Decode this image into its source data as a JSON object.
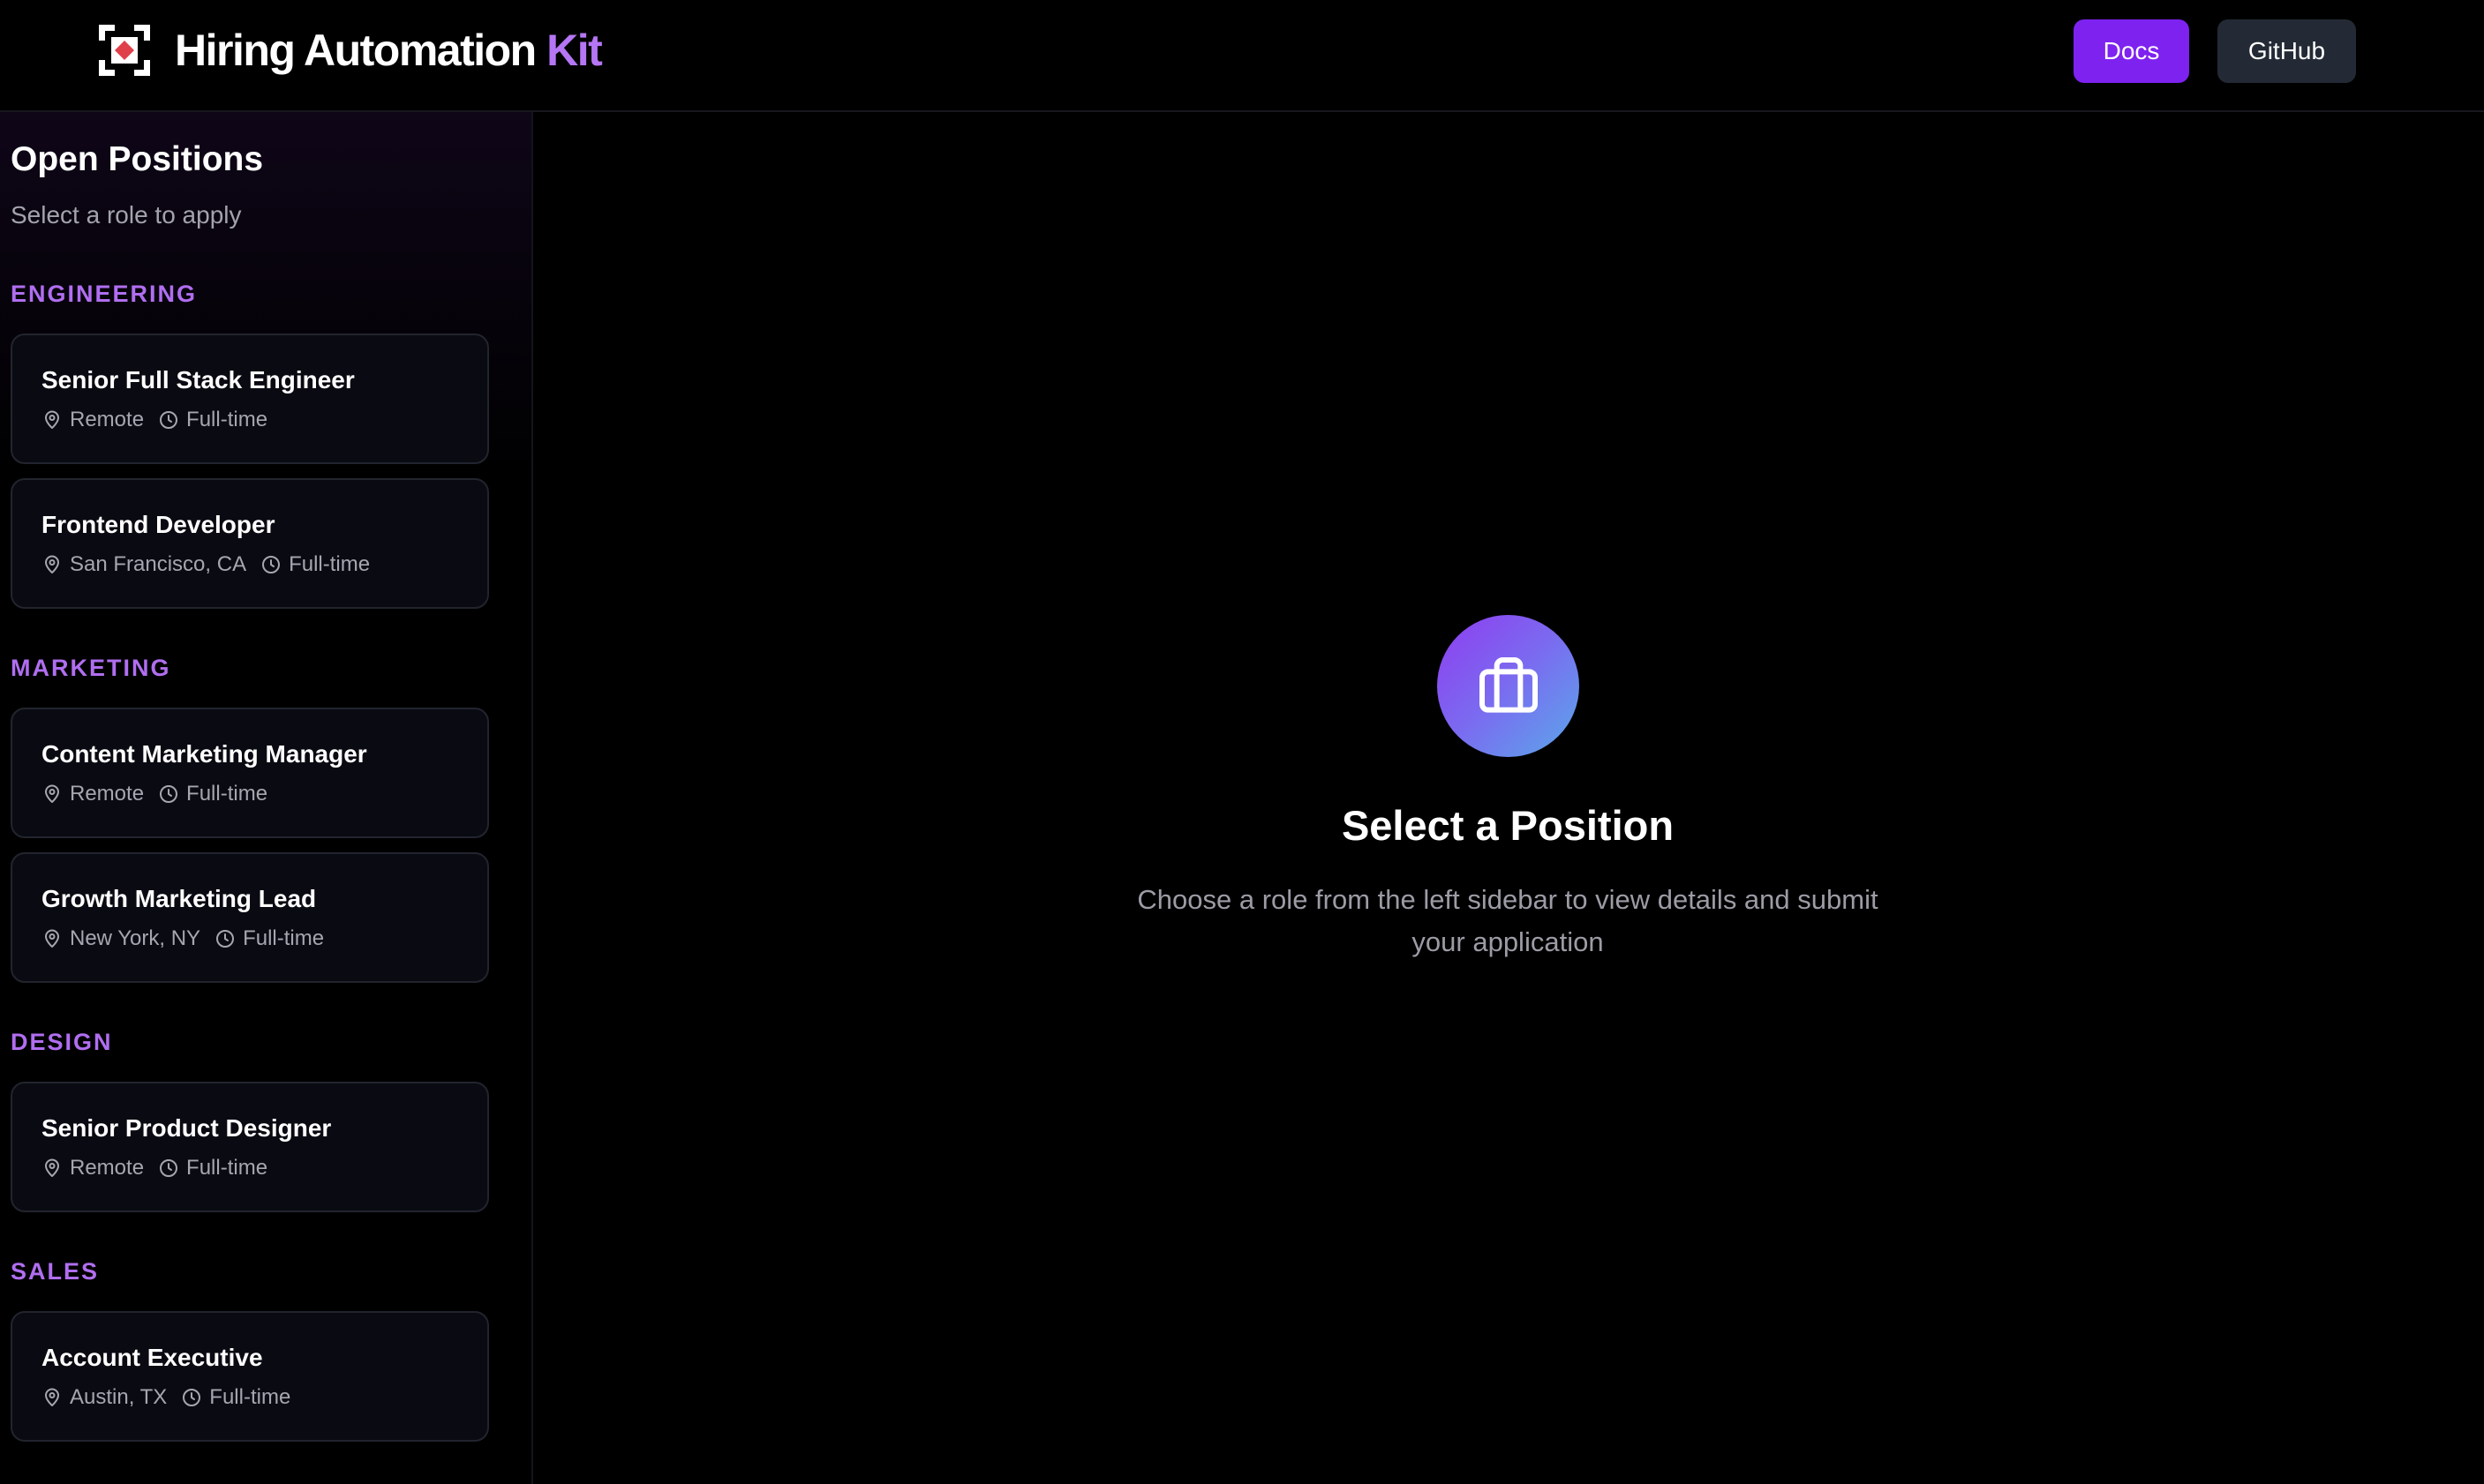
{
  "header": {
    "brand_name": "Hiring Automation",
    "brand_accent": "Kit",
    "docs_label": "Docs",
    "github_label": "GitHub"
  },
  "sidebar": {
    "title": "Open Positions",
    "subtitle": "Select a role to apply",
    "departments": [
      {
        "name": "ENGINEERING",
        "jobs": [
          {
            "title": "Senior Full Stack Engineer",
            "location": "Remote",
            "type": "Full-time"
          },
          {
            "title": "Frontend Developer",
            "location": "San Francisco, CA",
            "type": "Full-time"
          }
        ]
      },
      {
        "name": "MARKETING",
        "jobs": [
          {
            "title": "Content Marketing Manager",
            "location": "Remote",
            "type": "Full-time"
          },
          {
            "title": "Growth Marketing Lead",
            "location": "New York, NY",
            "type": "Full-time"
          }
        ]
      },
      {
        "name": "DESIGN",
        "jobs": [
          {
            "title": "Senior Product Designer",
            "location": "Remote",
            "type": "Full-time"
          }
        ]
      },
      {
        "name": "SALES",
        "jobs": [
          {
            "title": "Account Executive",
            "location": "Austin, TX",
            "type": "Full-time"
          }
        ]
      }
    ]
  },
  "main": {
    "empty_icon": "briefcase-icon",
    "empty_title": "Select a Position",
    "empty_description": "Choose a role from the left sidebar to view details and submit your application"
  },
  "colors": {
    "accent": "#7e22f0",
    "department_label": "#b06ef0",
    "brand_accent": "#b576f5",
    "background": "#000000"
  }
}
